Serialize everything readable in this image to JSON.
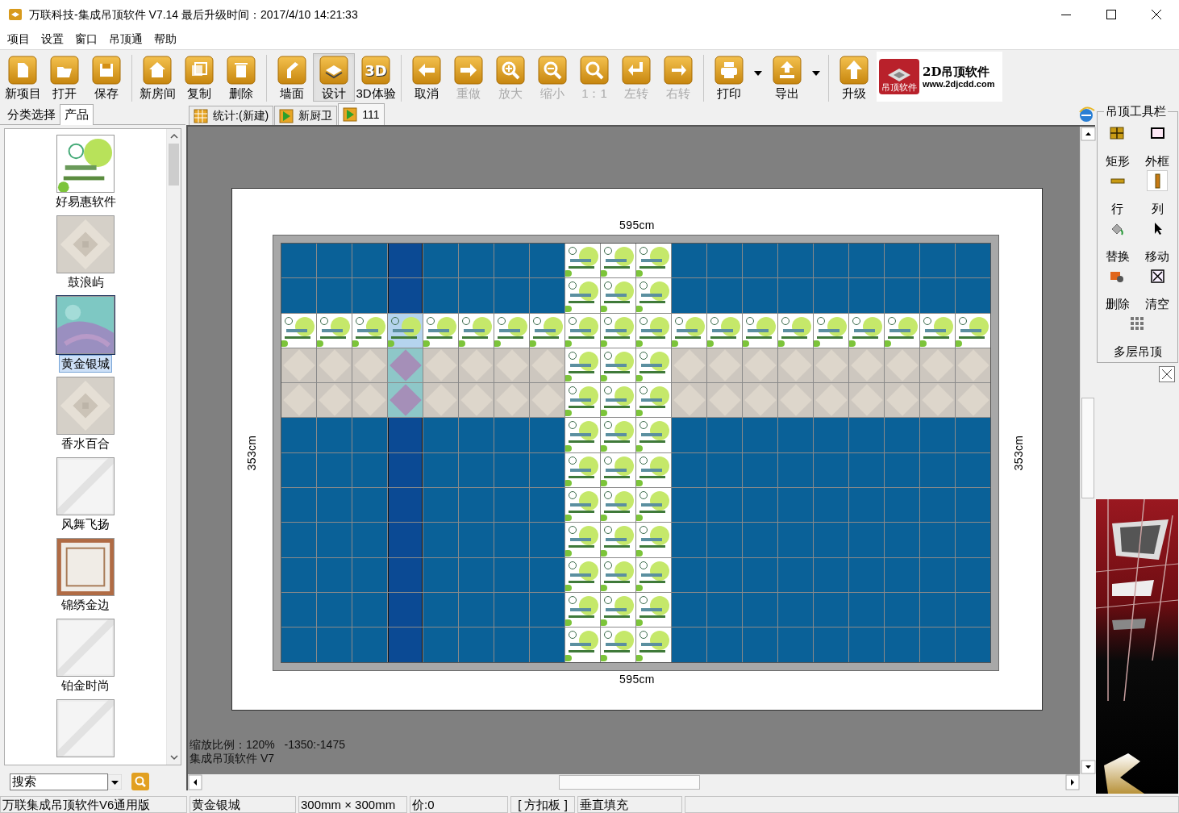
{
  "window": {
    "title": "万联科技-集成吊顶软件 V7.14 最后升级时间：2017/4/10 14:21:33"
  },
  "menu": [
    "项目",
    "设置",
    "窗口",
    "吊顶通",
    "帮助"
  ],
  "toolbar": [
    {
      "kind": "button",
      "label": "新项目",
      "disabled": false,
      "selected": false
    },
    {
      "kind": "button",
      "label": "打开",
      "disabled": false,
      "selected": false
    },
    {
      "kind": "button",
      "label": "保存",
      "disabled": false,
      "selected": false
    },
    {
      "kind": "separator"
    },
    {
      "kind": "button",
      "label": "新房间",
      "disabled": false,
      "selected": false
    },
    {
      "kind": "button",
      "label": "复制",
      "disabled": false,
      "selected": false
    },
    {
      "kind": "button",
      "label": "删除",
      "disabled": false,
      "selected": false
    },
    {
      "kind": "separator"
    },
    {
      "kind": "button",
      "label": "墙面",
      "disabled": false,
      "selected": false
    },
    {
      "kind": "button",
      "label": "设计",
      "disabled": false,
      "selected": true
    },
    {
      "kind": "button",
      "label": "3D体验",
      "icon_text": "3D",
      "disabled": false,
      "selected": false
    },
    {
      "kind": "separator"
    },
    {
      "kind": "button",
      "label": "取消",
      "disabled": false,
      "selected": false
    },
    {
      "kind": "button",
      "label": "重做",
      "disabled": true,
      "selected": false
    },
    {
      "kind": "button",
      "label": "放大",
      "disabled": true,
      "selected": false
    },
    {
      "kind": "button",
      "label": "缩小",
      "disabled": true,
      "selected": false
    },
    {
      "kind": "button",
      "label": "1：1",
      "disabled": true,
      "selected": false
    },
    {
      "kind": "button",
      "label": "左转",
      "disabled": true,
      "selected": false
    },
    {
      "kind": "button",
      "label": "右转",
      "disabled": true,
      "selected": false
    },
    {
      "kind": "separator"
    },
    {
      "kind": "dropdown",
      "label": "打印",
      "disabled": false,
      "selected": false
    },
    {
      "kind": "dropdown",
      "label": "导出",
      "disabled": false,
      "selected": false
    },
    {
      "kind": "separator"
    },
    {
      "kind": "button",
      "label": "升级",
      "disabled": false,
      "selected": false
    }
  ],
  "brand": {
    "badge": "吊顶软件",
    "name": "2D吊顶软件",
    "url": "www.2djcdd.com"
  },
  "left_tabs": [
    {
      "label": "分类选择",
      "selected": false
    },
    {
      "label": "产品",
      "selected": true
    }
  ],
  "products": [
    {
      "name": "好易惠软件",
      "kind": "hello",
      "selected": false
    },
    {
      "name": "鼓浪屿",
      "kind": "stone",
      "selected": false
    },
    {
      "name": "黄金银城",
      "kind": "teal",
      "selected": true
    },
    {
      "name": "香水百合",
      "kind": "stone",
      "selected": false
    },
    {
      "name": "风舞飞扬",
      "kind": "plain",
      "selected": false
    },
    {
      "name": "锦绣金边",
      "kind": "framed",
      "selected": false
    },
    {
      "name": "铂金时尚",
      "kind": "plain",
      "selected": false
    },
    {
      "kind": "plain",
      "selected": false
    }
  ],
  "search": {
    "value": "搜索"
  },
  "doc_tabs": [
    {
      "label": "统计:(新建)",
      "kind": "table",
      "selected": false
    },
    {
      "label": "新厨卫",
      "kind": "room",
      "selected": false
    },
    {
      "label": "111",
      "kind": "room",
      "selected": true
    }
  ],
  "canvas": {
    "width_top": "595cm",
    "width_bottom": "595cm",
    "height_left": "353cm",
    "height_right": "353cm",
    "columns": [
      {
        "selected": false
      },
      {
        "selected": false
      },
      {
        "selected": false
      },
      {
        "selected": true
      },
      {
        "selected": false
      },
      {
        "selected": false
      },
      {
        "selected": false
      },
      {
        "selected": false
      },
      {
        "selected": false
      },
      {
        "selected": false
      },
      {
        "selected": false
      },
      {
        "selected": false
      },
      {
        "selected": false
      },
      {
        "selected": false
      },
      {
        "selected": false
      },
      {
        "selected": false
      },
      {
        "selected": false
      },
      {
        "selected": false
      },
      {
        "selected": false
      },
      {
        "selected": false
      }
    ],
    "rows": [
      {
        "tiles": [
          {
            "kind": "blue"
          },
          {
            "kind": "blue"
          },
          {
            "kind": "blue"
          },
          {
            "kind": "blue"
          },
          {
            "kind": "blue"
          },
          {
            "kind": "blue"
          },
          {
            "kind": "blue"
          },
          {
            "kind": "blue"
          },
          {
            "kind": "hello"
          },
          {
            "kind": "hello"
          },
          {
            "kind": "hello"
          },
          {
            "kind": "blue"
          },
          {
            "kind": "blue"
          },
          {
            "kind": "blue"
          },
          {
            "kind": "blue"
          },
          {
            "kind": "blue"
          },
          {
            "kind": "blue"
          },
          {
            "kind": "blue"
          },
          {
            "kind": "blue"
          },
          {
            "kind": "blue"
          }
        ]
      },
      {
        "tiles": [
          {
            "kind": "blue"
          },
          {
            "kind": "blue"
          },
          {
            "kind": "blue"
          },
          {
            "kind": "blue"
          },
          {
            "kind": "blue"
          },
          {
            "kind": "blue"
          },
          {
            "kind": "blue"
          },
          {
            "kind": "blue"
          },
          {
            "kind": "hello"
          },
          {
            "kind": "hello"
          },
          {
            "kind": "hello"
          },
          {
            "kind": "blue"
          },
          {
            "kind": "blue"
          },
          {
            "kind": "blue"
          },
          {
            "kind": "blue"
          },
          {
            "kind": "blue"
          },
          {
            "kind": "blue"
          },
          {
            "kind": "blue"
          },
          {
            "kind": "blue"
          },
          {
            "kind": "blue"
          }
        ]
      },
      {
        "tiles": [
          {
            "kind": "hello"
          },
          {
            "kind": "hello"
          },
          {
            "kind": "hello"
          },
          {
            "kind": "hello"
          },
          {
            "kind": "hello"
          },
          {
            "kind": "hello"
          },
          {
            "kind": "hello"
          },
          {
            "kind": "hello"
          },
          {
            "kind": "hello"
          },
          {
            "kind": "hello"
          },
          {
            "kind": "hello"
          },
          {
            "kind": "hello"
          },
          {
            "kind": "hello"
          },
          {
            "kind": "hello"
          },
          {
            "kind": "hello"
          },
          {
            "kind": "hello"
          },
          {
            "kind": "hello"
          },
          {
            "kind": "hello"
          },
          {
            "kind": "hello"
          },
          {
            "kind": "hello"
          }
        ]
      },
      {
        "tiles": [
          {
            "kind": "stone"
          },
          {
            "kind": "stone"
          },
          {
            "kind": "stone"
          },
          {
            "kind": "stone"
          },
          {
            "kind": "stone"
          },
          {
            "kind": "stone"
          },
          {
            "kind": "stone"
          },
          {
            "kind": "stone"
          },
          {
            "kind": "hello"
          },
          {
            "kind": "hello"
          },
          {
            "kind": "hello"
          },
          {
            "kind": "stone"
          },
          {
            "kind": "stone"
          },
          {
            "kind": "stone"
          },
          {
            "kind": "stone"
          },
          {
            "kind": "stone"
          },
          {
            "kind": "stone"
          },
          {
            "kind": "stone"
          },
          {
            "kind": "stone"
          },
          {
            "kind": "stone"
          }
        ]
      },
      {
        "tiles": [
          {
            "kind": "stone"
          },
          {
            "kind": "stone"
          },
          {
            "kind": "stone"
          },
          {
            "kind": "stone"
          },
          {
            "kind": "stone"
          },
          {
            "kind": "stone"
          },
          {
            "kind": "stone"
          },
          {
            "kind": "stone"
          },
          {
            "kind": "hello"
          },
          {
            "kind": "hello"
          },
          {
            "kind": "hello"
          },
          {
            "kind": "stone"
          },
          {
            "kind": "stone"
          },
          {
            "kind": "stone"
          },
          {
            "kind": "stone"
          },
          {
            "kind": "stone"
          },
          {
            "kind": "stone"
          },
          {
            "kind": "stone"
          },
          {
            "kind": "stone"
          },
          {
            "kind": "stone"
          }
        ]
      },
      {
        "tiles": [
          {
            "kind": "blue"
          },
          {
            "kind": "blue"
          },
          {
            "kind": "blue"
          },
          {
            "kind": "blue"
          },
          {
            "kind": "blue"
          },
          {
            "kind": "blue"
          },
          {
            "kind": "blue"
          },
          {
            "kind": "blue"
          },
          {
            "kind": "hello"
          },
          {
            "kind": "hello"
          },
          {
            "kind": "hello"
          },
          {
            "kind": "blue"
          },
          {
            "kind": "blue"
          },
          {
            "kind": "blue"
          },
          {
            "kind": "blue"
          },
          {
            "kind": "blue"
          },
          {
            "kind": "blue"
          },
          {
            "kind": "blue"
          },
          {
            "kind": "blue"
          },
          {
            "kind": "blue"
          }
        ]
      },
      {
        "tiles": [
          {
            "kind": "blue"
          },
          {
            "kind": "blue"
          },
          {
            "kind": "blue"
          },
          {
            "kind": "blue"
          },
          {
            "kind": "blue"
          },
          {
            "kind": "blue"
          },
          {
            "kind": "blue"
          },
          {
            "kind": "blue"
          },
          {
            "kind": "hello"
          },
          {
            "kind": "hello"
          },
          {
            "kind": "hello"
          },
          {
            "kind": "blue"
          },
          {
            "kind": "blue"
          },
          {
            "kind": "blue"
          },
          {
            "kind": "blue"
          },
          {
            "kind": "blue"
          },
          {
            "kind": "blue"
          },
          {
            "kind": "blue"
          },
          {
            "kind": "blue"
          },
          {
            "kind": "blue"
          }
        ]
      },
      {
        "tiles": [
          {
            "kind": "blue"
          },
          {
            "kind": "blue"
          },
          {
            "kind": "blue"
          },
          {
            "kind": "blue"
          },
          {
            "kind": "blue"
          },
          {
            "kind": "blue"
          },
          {
            "kind": "blue"
          },
          {
            "kind": "blue"
          },
          {
            "kind": "hello"
          },
          {
            "kind": "hello"
          },
          {
            "kind": "hello"
          },
          {
            "kind": "blue"
          },
          {
            "kind": "blue"
          },
          {
            "kind": "blue"
          },
          {
            "kind": "blue"
          },
          {
            "kind": "blue"
          },
          {
            "kind": "blue"
          },
          {
            "kind": "blue"
          },
          {
            "kind": "blue"
          },
          {
            "kind": "blue"
          }
        ]
      },
      {
        "tiles": [
          {
            "kind": "blue"
          },
          {
            "kind": "blue"
          },
          {
            "kind": "blue"
          },
          {
            "kind": "blue"
          },
          {
            "kind": "blue"
          },
          {
            "kind": "blue"
          },
          {
            "kind": "blue"
          },
          {
            "kind": "blue"
          },
          {
            "kind": "hello"
          },
          {
            "kind": "hello"
          },
          {
            "kind": "hello"
          },
          {
            "kind": "blue"
          },
          {
            "kind": "blue"
          },
          {
            "kind": "blue"
          },
          {
            "kind": "blue"
          },
          {
            "kind": "blue"
          },
          {
            "kind": "blue"
          },
          {
            "kind": "blue"
          },
          {
            "kind": "blue"
          },
          {
            "kind": "blue"
          }
        ]
      },
      {
        "tiles": [
          {
            "kind": "blue"
          },
          {
            "kind": "blue"
          },
          {
            "kind": "blue"
          },
          {
            "kind": "blue"
          },
          {
            "kind": "blue"
          },
          {
            "kind": "blue"
          },
          {
            "kind": "blue"
          },
          {
            "kind": "blue"
          },
          {
            "kind": "hello"
          },
          {
            "kind": "hello"
          },
          {
            "kind": "hello"
          },
          {
            "kind": "blue"
          },
          {
            "kind": "blue"
          },
          {
            "kind": "blue"
          },
          {
            "kind": "blue"
          },
          {
            "kind": "blue"
          },
          {
            "kind": "blue"
          },
          {
            "kind": "blue"
          },
          {
            "kind": "blue"
          },
          {
            "kind": "blue"
          }
        ]
      },
      {
        "tiles": [
          {
            "kind": "blue"
          },
          {
            "kind": "blue"
          },
          {
            "kind": "blue"
          },
          {
            "kind": "blue"
          },
          {
            "kind": "blue"
          },
          {
            "kind": "blue"
          },
          {
            "kind": "blue"
          },
          {
            "kind": "blue"
          },
          {
            "kind": "hello"
          },
          {
            "kind": "hello"
          },
          {
            "kind": "hello"
          },
          {
            "kind": "blue"
          },
          {
            "kind": "blue"
          },
          {
            "kind": "blue"
          },
          {
            "kind": "blue"
          },
          {
            "kind": "blue"
          },
          {
            "kind": "blue"
          },
          {
            "kind": "blue"
          },
          {
            "kind": "blue"
          },
          {
            "kind": "blue"
          }
        ]
      },
      {
        "tiles": [
          {
            "kind": "blue"
          },
          {
            "kind": "blue"
          },
          {
            "kind": "blue"
          },
          {
            "kind": "blue"
          },
          {
            "kind": "blue"
          },
          {
            "kind": "blue"
          },
          {
            "kind": "blue"
          },
          {
            "kind": "blue"
          },
          {
            "kind": "hello"
          },
          {
            "kind": "hello"
          },
          {
            "kind": "hello"
          },
          {
            "kind": "blue"
          },
          {
            "kind": "blue"
          },
          {
            "kind": "blue"
          },
          {
            "kind": "blue"
          },
          {
            "kind": "blue"
          },
          {
            "kind": "blue"
          },
          {
            "kind": "blue"
          },
          {
            "kind": "blue"
          },
          {
            "kind": "blue"
          }
        ]
      }
    ],
    "zoom_info": "缩放比例：120%   -1350:-1475",
    "version_info": "集成吊顶软件 V7"
  },
  "toolbox": {
    "title": "吊顶工具栏",
    "tools": [
      {
        "label": "矩形",
        "selected": false
      },
      {
        "label": "外框",
        "selected": false
      },
      {
        "label": "行",
        "selected": false
      },
      {
        "label": "列",
        "selected": true
      },
      {
        "label": "替换",
        "selected": false
      },
      {
        "label": "移动",
        "selected": false
      },
      {
        "label": "删除",
        "selected": false
      },
      {
        "label": "清空",
        "selected": false
      },
      {
        "label": "多层吊顶",
        "selected": false
      }
    ]
  },
  "status_bar": [
    "万联集成吊顶软件V6通用版",
    "黄金银城",
    "300mm × 300mm",
    "价:0",
    "[ 方扣板 ]",
    "垂直填充"
  ]
}
